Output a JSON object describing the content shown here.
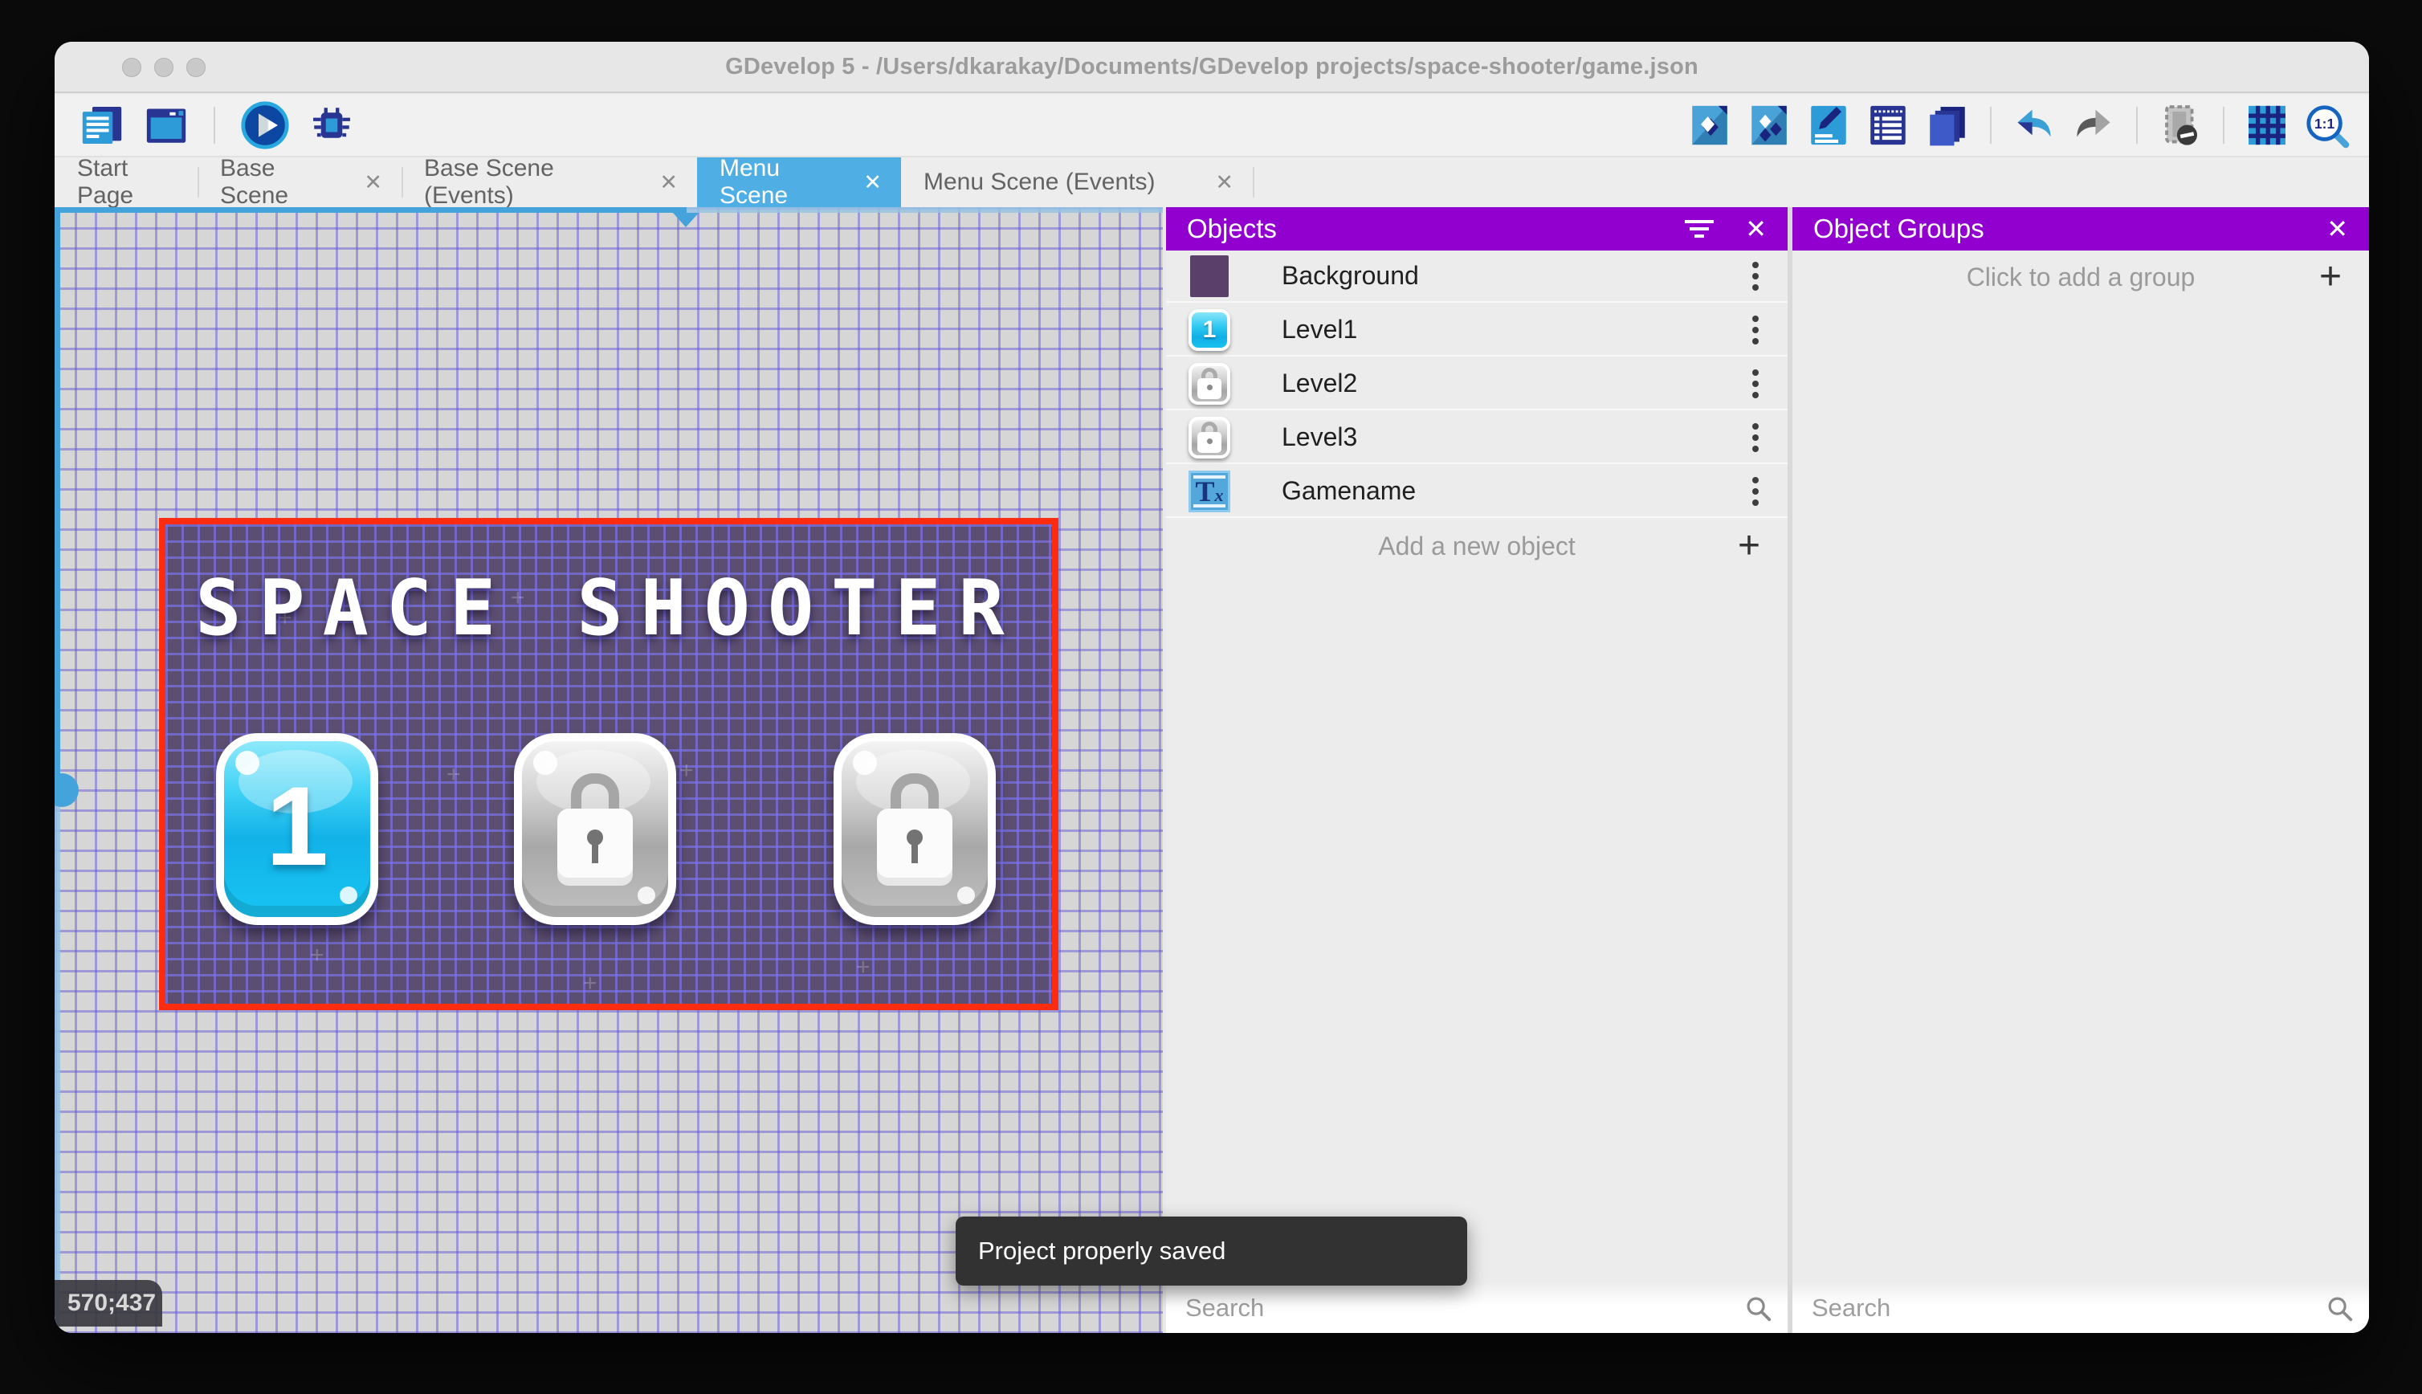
{
  "window": {
    "title": "GDevelop 5 - /Users/dkarakay/Documents/GDevelop projects/space-shooter/game.json"
  },
  "toolbar": {
    "left_icons": [
      "project-manager-icon",
      "preview-window-icon",
      "play-preview-icon",
      "debug-icon"
    ],
    "right_icons": [
      "edit-objects-icon",
      "edit-object-groups-icon",
      "edit-properties-icon",
      "instances-list-icon",
      "layers-icon",
      "undo-icon",
      "redo-icon",
      "toggle-mask-icon",
      "toggle-grid-icon",
      "zoom-original-icon"
    ]
  },
  "tabs": [
    {
      "label": "Start Page",
      "closable": false,
      "active": false
    },
    {
      "label": "Base Scene",
      "closable": true,
      "active": false
    },
    {
      "label": "Base Scene (Events)",
      "closable": true,
      "active": false
    },
    {
      "label": "Menu Scene",
      "closable": true,
      "active": true
    },
    {
      "label": "Menu Scene (Events)",
      "closable": true,
      "active": false
    }
  ],
  "canvas": {
    "coordinates_badge": "570;437",
    "scene": {
      "title": "SPACE SHOOTER",
      "level_buttons": [
        {
          "label": "1",
          "state": "unlocked"
        },
        {
          "label": "",
          "state": "locked"
        },
        {
          "label": "",
          "state": "locked"
        }
      ]
    }
  },
  "objects_panel": {
    "title": "Objects",
    "rows": [
      {
        "name": "Background",
        "icon": "background-thumbnail"
      },
      {
        "name": "Level1",
        "icon": "level1-button-thumbnail"
      },
      {
        "name": "Level2",
        "icon": "locked-button-thumbnail"
      },
      {
        "name": "Level3",
        "icon": "locked-button-thumbnail"
      },
      {
        "name": "Gamename",
        "icon": "text-object-thumbnail"
      }
    ],
    "add_button_label": "Add a new object",
    "search_placeholder": "Search"
  },
  "object_groups_panel": {
    "title": "Object Groups",
    "empty_action_label": "Click to add a group",
    "search_placeholder": "Search"
  },
  "toast": {
    "message": "Project properly saved"
  },
  "colors": {
    "panel_header": "#9100ce",
    "active_tab": "#4faee4",
    "selection_border": "#fb2c0f",
    "scene_background": "#5c4e70",
    "grid_line": "#6f66d6",
    "scrollbar": "#45a3dc",
    "toast_background": "#323232"
  }
}
